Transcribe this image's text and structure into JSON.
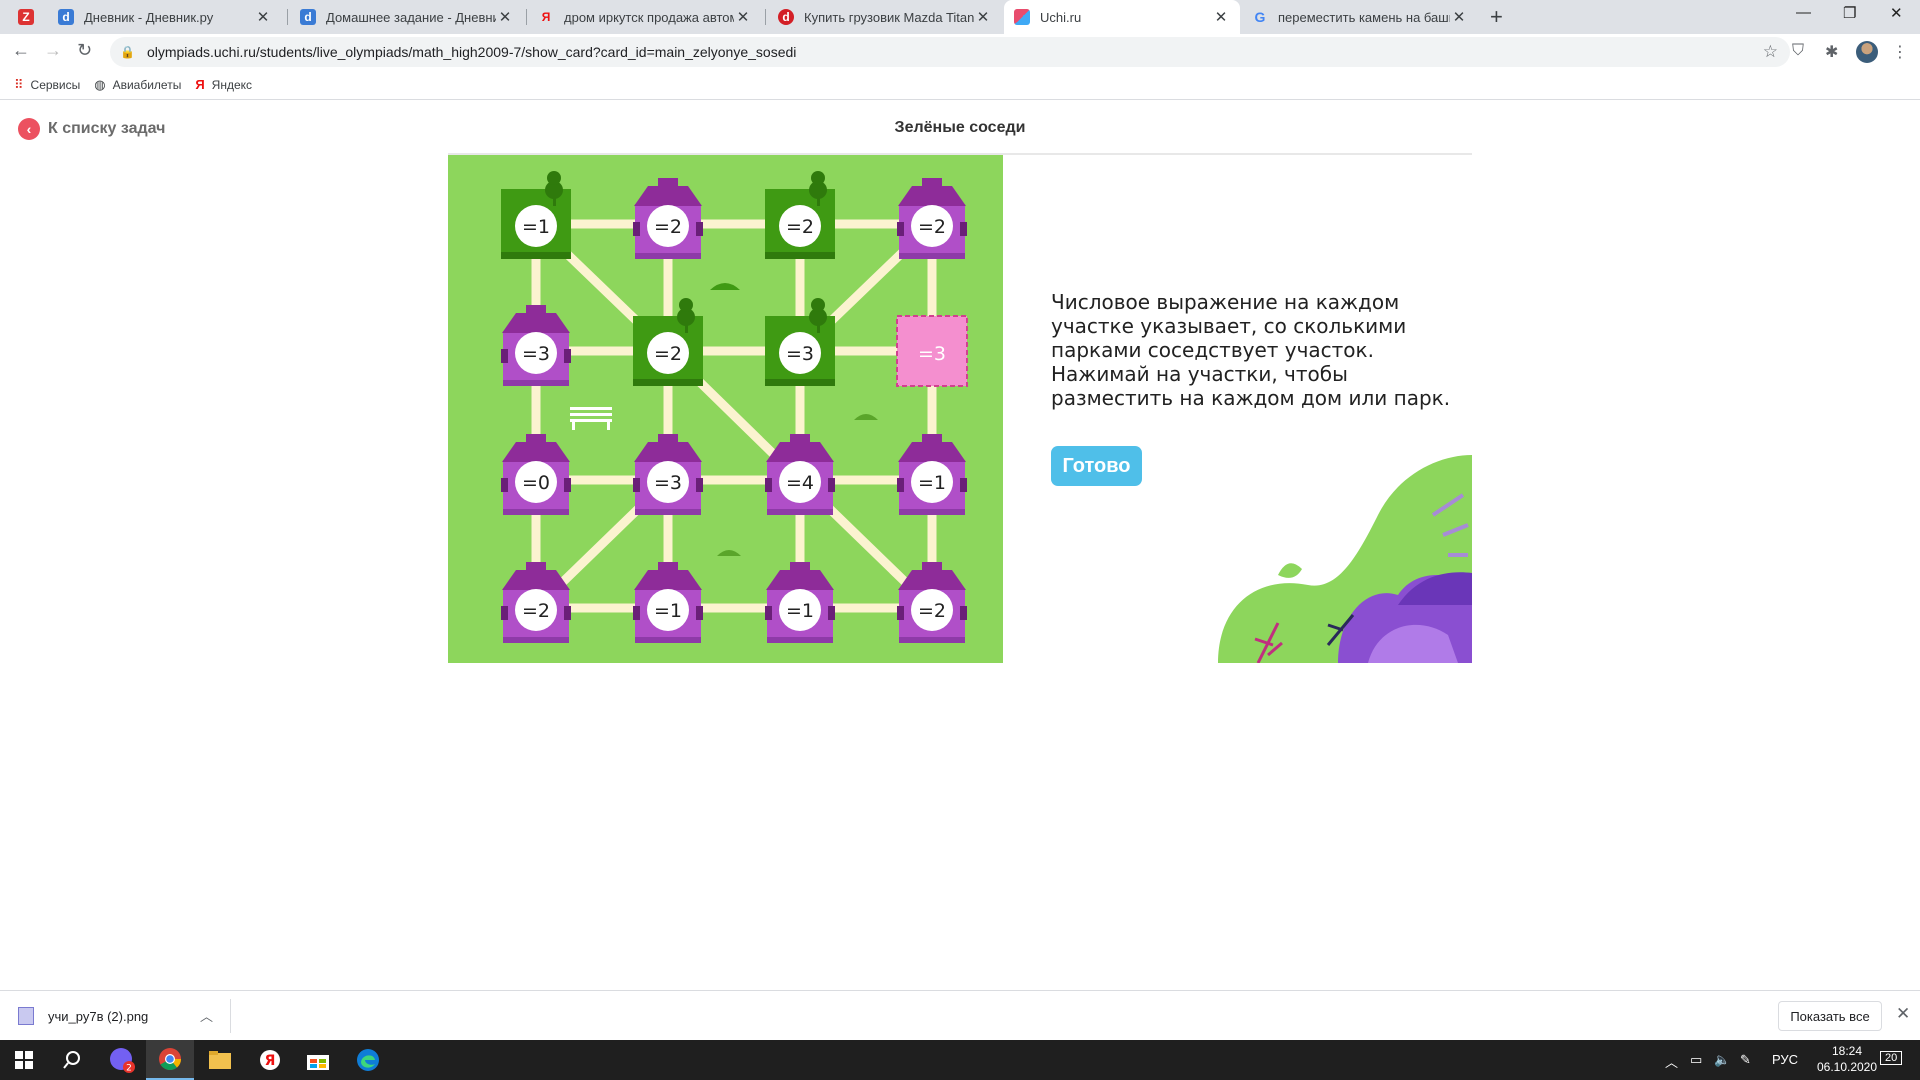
{
  "browser": {
    "tabs": [
      {
        "title": "Дневник - Дневник.ру",
        "icon": "dnevnik-icon",
        "active": false
      },
      {
        "title": "Домашнее задание - Дневник.р",
        "icon": "dnevnik-icon",
        "active": false
      },
      {
        "title": "дром иркутск продажа автомоб",
        "icon": "yandex-icon",
        "active": false
      },
      {
        "title": "Купить грузовик Mazda Titan, ег",
        "icon": "drom-icon",
        "active": false
      },
      {
        "title": "Uchi.ru",
        "icon": "uchi-icon",
        "active": true
      },
      {
        "title": "переместить камень на башню",
        "icon": "google-icon",
        "active": false
      }
    ],
    "url": "olympiads.uchi.ru/students/live_olympiads/math_high2009-7/show_card?card_id=main_zelyonye_sosedi",
    "bookmarks": [
      {
        "label": "Сервисы",
        "icon": "apps-grid-icon"
      },
      {
        "label": "Авиабилеты",
        "icon": "globe-icon"
      },
      {
        "label": "Яндекс",
        "icon": "yandex-icon"
      }
    ]
  },
  "page": {
    "back_label": "К списку задач",
    "title": "Зелёные соседи",
    "instructions": "Числовое выражение на каждом участке указывает, со сколькими парками соседствует участок. Нажимай на участки, чтобы разместить на каждом дом или парк.",
    "done_label": "Готово"
  },
  "board": {
    "cells": [
      [
        {
          "label": "=1",
          "type": "park"
        },
        {
          "label": "=2",
          "type": "house"
        },
        {
          "label": "=2",
          "type": "park"
        },
        {
          "label": "=2",
          "type": "house"
        }
      ],
      [
        {
          "label": "=3",
          "type": "house"
        },
        {
          "label": "=2",
          "type": "park"
        },
        {
          "label": "=3",
          "type": "park"
        },
        {
          "label": "=3",
          "type": "empty"
        }
      ],
      [
        {
          "label": "=0",
          "type": "house"
        },
        {
          "label": "=3",
          "type": "house"
        },
        {
          "label": "=4",
          "type": "house"
        },
        {
          "label": "=1",
          "type": "house"
        }
      ],
      [
        {
          "label": "=2",
          "type": "house"
        },
        {
          "label": "=1",
          "type": "house"
        },
        {
          "label": "=1",
          "type": "house"
        },
        {
          "label": "=2",
          "type": "house"
        }
      ]
    ],
    "colors": {
      "grass": "#8dd65c",
      "road": "#fbf3d0",
      "park": "#3f9a13",
      "house": "#b04fc8",
      "roof": "#8e2c99",
      "empty": "#f48fcf"
    }
  },
  "downloads": {
    "file_name": "учи_ру7в (2).png",
    "show_all_label": "Показать все"
  },
  "taskbar": {
    "language": "РУС",
    "time": "18:24",
    "date": "06.10.2020",
    "notifications": "20",
    "viber_badge": "2"
  }
}
